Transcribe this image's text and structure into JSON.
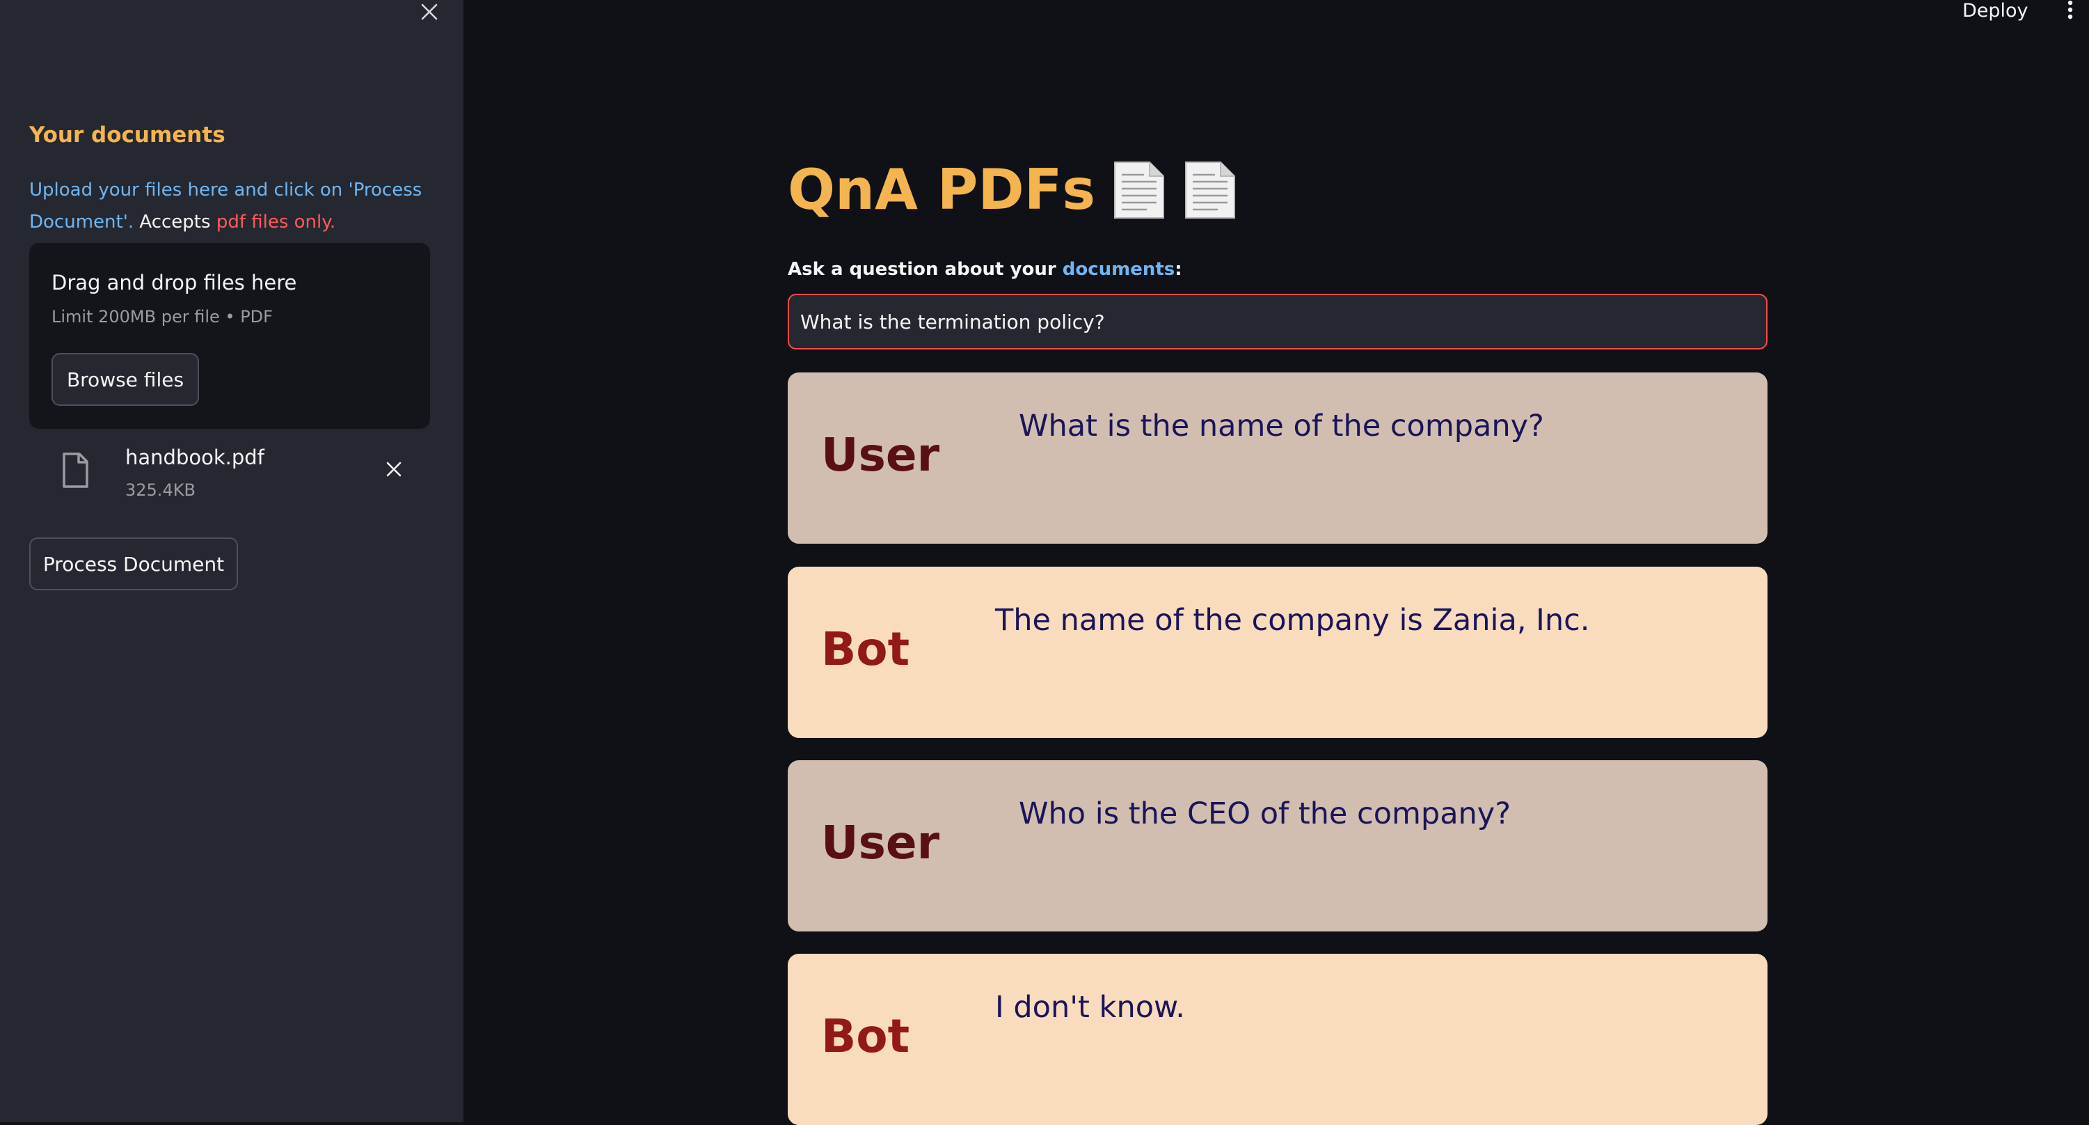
{
  "sidebar": {
    "title": "Your documents",
    "description": {
      "part1": "Upload your files here and click on 'Process Document'.",
      "part2": " Accepts ",
      "part3": "pdf files only."
    },
    "uploader": {
      "drag_text": "Drag and drop files here",
      "limit_text": "Limit 200MB per file • PDF",
      "browse_label": "Browse files"
    },
    "file": {
      "name": "handbook.pdf",
      "size": "325.4KB"
    },
    "process_label": "Process Document"
  },
  "header": {
    "deploy_label": "Deploy"
  },
  "main": {
    "title": "QnA PDFs",
    "title_icons": [
      "document-icon",
      "document-icon"
    ],
    "prompt": {
      "part1": "Ask a question about your ",
      "part2": "documents",
      "part3": ":"
    },
    "input_value": "What is the termination policy?",
    "messages": [
      {
        "speaker": "User",
        "text": "What is the name of the company?"
      },
      {
        "speaker": "Bot",
        "text": "The name of the company is Zania, Inc."
      },
      {
        "speaker": "User",
        "text": "Who is the CEO of the company?"
      },
      {
        "speaker": "Bot",
        "text": "I don't know."
      }
    ]
  },
  "colors": {
    "accent": "#f4b44f",
    "link": "#6fb5f3",
    "warning": "#ff5b5b",
    "user_bg": "#d1beb0",
    "bot_bg": "#f9dbbd",
    "user_speaker": "#591015",
    "bot_speaker": "#931818",
    "message_text": "#1a1459"
  }
}
